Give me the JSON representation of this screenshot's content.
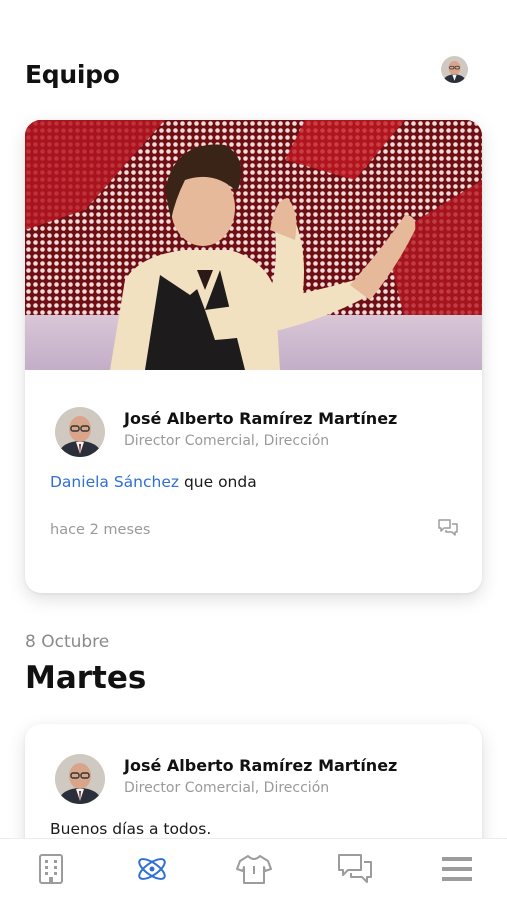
{
  "header": {
    "title": "Equipo",
    "avatar_icon": "user-avatar"
  },
  "posts": [
    {
      "image": "clapping-man-gif",
      "author_name": "José Alberto Ramírez Martínez",
      "author_role": "Director Comercial, Dirección",
      "mention": "Daniela Sánchez",
      "text": " que onda",
      "time": "hace 2 meses",
      "comment_icon": "comment-icon"
    },
    {
      "author_name": "José Alberto Ramírez Martínez",
      "author_role": "Director Comercial, Dirección",
      "text": "Buenos días a todos."
    }
  ],
  "section": {
    "date": "8 Octubre",
    "day": "Martes"
  },
  "tabbar": {
    "tabs": [
      {
        "icon": "building-icon",
        "active": false
      },
      {
        "icon": "atom-icon",
        "active": true
      },
      {
        "icon": "shirt-icon",
        "active": false
      },
      {
        "icon": "chat-icon",
        "active": false
      },
      {
        "icon": "menu-icon",
        "active": false
      }
    ],
    "active_color": "#2f6fd6",
    "inactive_color": "#9c9c9c"
  }
}
